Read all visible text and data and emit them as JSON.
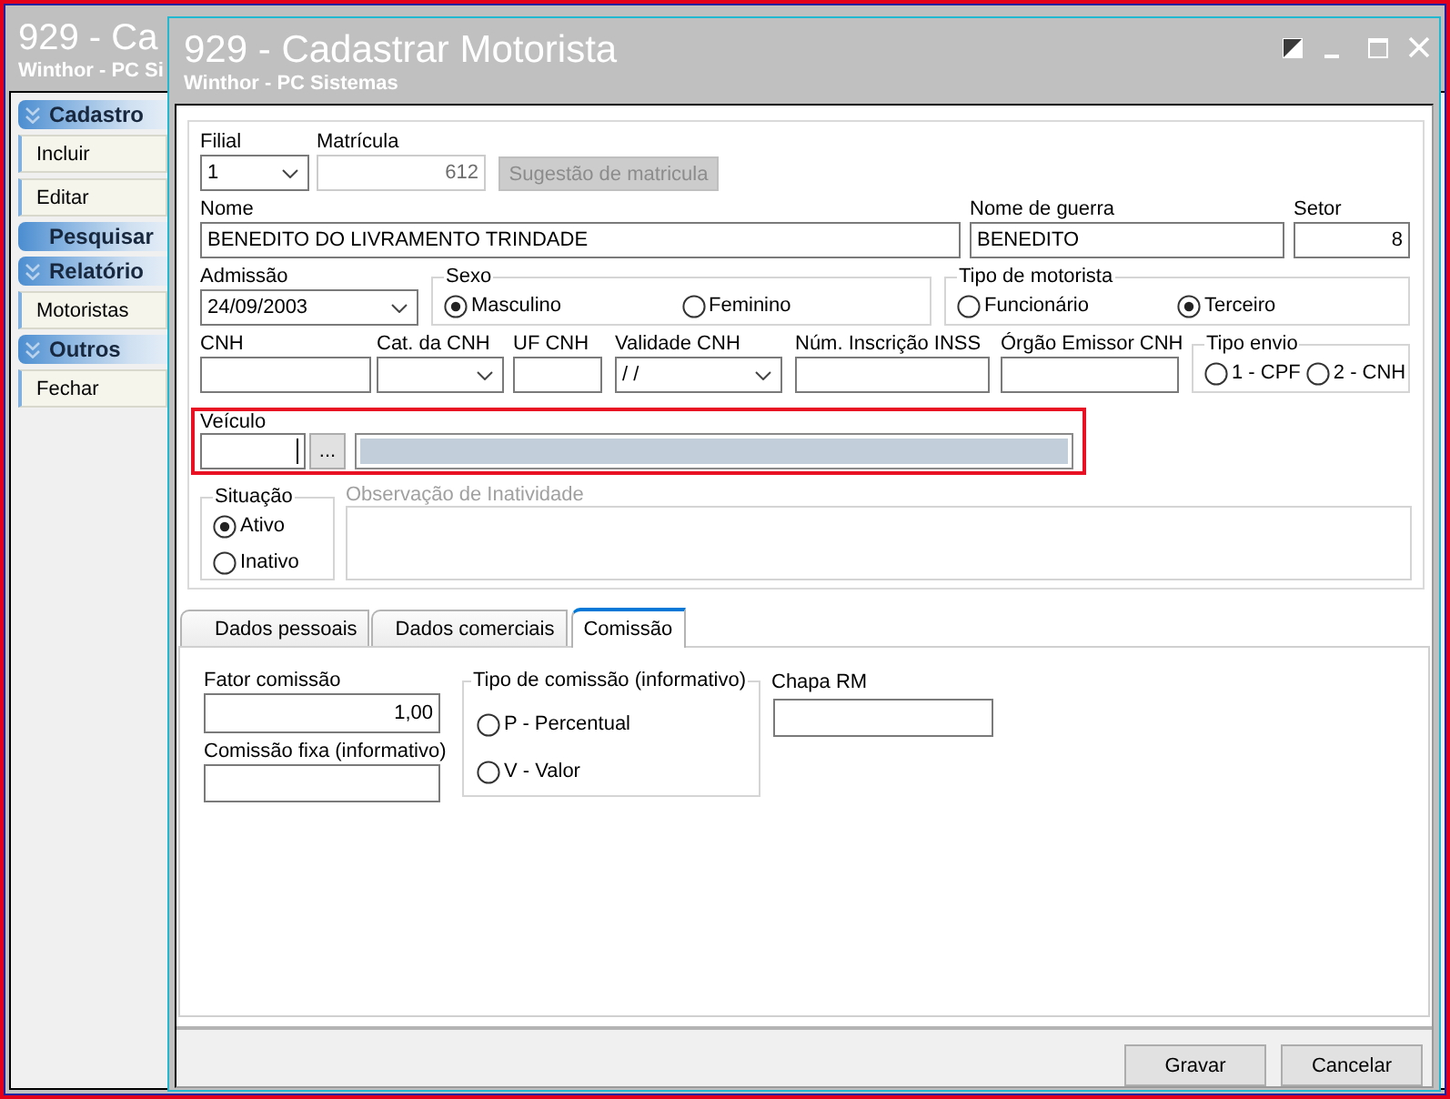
{
  "back_window": {
    "title": "929 - Ca",
    "subtitle": "Winthor - PC Si"
  },
  "sidebar": {
    "groups": [
      {
        "title": "Cadastro",
        "expanded": true,
        "items": [
          {
            "label": "Incluir"
          },
          {
            "label": "Editar"
          }
        ]
      },
      {
        "title": "Pesquisar",
        "expanded": false
      },
      {
        "title": "Relatório",
        "expanded": true,
        "items": [
          {
            "label": "Motoristas"
          }
        ]
      },
      {
        "title": "Outros",
        "expanded": true,
        "items": [
          {
            "label": "Fechar"
          }
        ]
      }
    ]
  },
  "dialog": {
    "title": "929 - Cadastrar Motorista",
    "subtitle": "Winthor - PC Sistemas"
  },
  "form": {
    "fields": [
      {
        "kind": "combo",
        "label": "Filial",
        "value": "1",
        "disabled": false
      },
      {
        "kind": "input",
        "label": "Matrícula",
        "value": "612",
        "disabled": true
      },
      {
        "kind": "button",
        "text": "Sugestão de matricula",
        "disabled": true
      },
      {
        "kind": "input",
        "label": "Nome",
        "value": "BENEDITO DO LIVRAMENTO TRINDADE",
        "disabled": false
      },
      {
        "kind": "input",
        "label": "Nome de guerra",
        "value": "BENEDITO",
        "disabled": false
      },
      {
        "kind": "input",
        "label": "Setor",
        "value": "8",
        "disabled": false
      },
      {
        "kind": "combo",
        "label": "Admissão",
        "value": "24/09/2003",
        "disabled": false
      },
      {
        "kind": "radio_group",
        "label": "Sexo",
        "options": [
          {
            "label": "Masculino",
            "selected": true
          },
          {
            "label": "Feminino",
            "selected": false
          }
        ]
      },
      {
        "kind": "radio_group",
        "label": "Tipo de motorista",
        "options": [
          {
            "label": "Funcionário",
            "selected": false
          },
          {
            "label": "Terceiro",
            "selected": true
          }
        ]
      },
      {
        "kind": "input",
        "label": "CNH",
        "disabled": false
      },
      {
        "kind": "combo",
        "label": "Cat. da CNH",
        "disabled": false
      },
      {
        "kind": "input",
        "label": "UF CNH",
        "disabled": false
      },
      {
        "kind": "combo",
        "label": "Validade CNH",
        "value": "/ /",
        "disabled": false
      },
      {
        "kind": "input",
        "label": "Núm. Inscrição INSS",
        "disabled": false
      },
      {
        "kind": "input",
        "label": "Órgão Emissor CNH",
        "disabled": false
      },
      {
        "kind": "radio_group",
        "label": "Tipo envio",
        "options": [
          {
            "label": "1 - CPF",
            "selected": false
          },
          {
            "label": "2 - CNH",
            "selected": false
          }
        ]
      }
    ],
    "vehicle": {
      "label": "Veículo",
      "highlighted": true,
      "code": {
        "focused": true
      },
      "lookup_button": {
        "text": "..."
      },
      "description": {
        "disabled": true
      }
    },
    "situation": {
      "label": "Situação",
      "options": [
        {
          "label": "Ativo",
          "selected": true
        },
        {
          "label": "Inativo",
          "selected": false
        }
      ]
    },
    "observation": {
      "label": "Observação de Inatividade",
      "disabled": true
    }
  },
  "tabs": [
    {
      "label": "Dados pessoais",
      "selected": false
    },
    {
      "label": "Dados comerciais",
      "selected": false
    },
    {
      "label": "Comissão",
      "selected": true
    }
  ],
  "commission": {
    "factor": {
      "label": "Fator comissão",
      "value": "1,00"
    },
    "fixed": {
      "label": "Comissão fixa (informativo)"
    },
    "type": {
      "label": "Tipo de comissão (informativo)",
      "options": [
        {
          "label": "P - Percentual",
          "selected": false
        },
        {
          "label": "V - Valor",
          "selected": false
        }
      ]
    },
    "chapa": {
      "label": "Chapa RM"
    }
  },
  "buttons": [
    {
      "text": "Gravar"
    },
    {
      "text": "Cancelar"
    }
  ]
}
